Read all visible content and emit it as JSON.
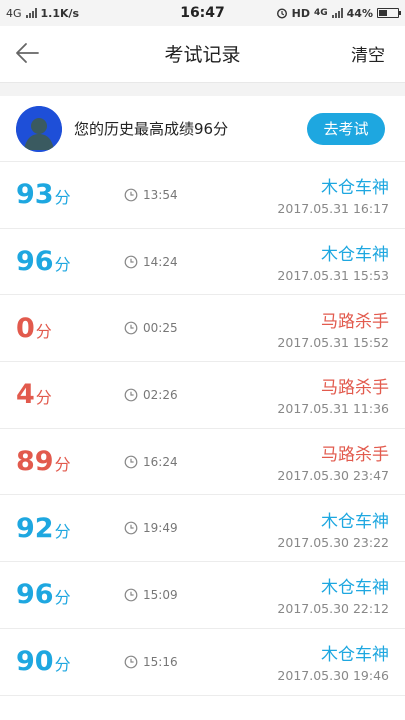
{
  "status": {
    "net": "4G",
    "speed": "1.1K/s",
    "time": "16:47",
    "hd": "HD",
    "net2": "4G",
    "battery": "44%",
    "battery_level": 0.44
  },
  "header": {
    "title": "考试记录",
    "clear": "清空",
    "back_icon": "arrow-left-icon"
  },
  "best": {
    "text": "您的历史最高成绩96分",
    "button": "去考试"
  },
  "colors": {
    "pass": "#1ea7e0",
    "fail": "#e25a4d"
  },
  "unit": "分",
  "records": [
    {
      "score": "93",
      "duration": "13:54",
      "title": "木仓车神",
      "date": "2017.05.31  16:17",
      "status": "pass"
    },
    {
      "score": "96",
      "duration": "14:24",
      "title": "木仓车神",
      "date": "2017.05.31  15:53",
      "status": "pass"
    },
    {
      "score": "0",
      "duration": "00:25",
      "title": "马路杀手",
      "date": "2017.05.31  15:52",
      "status": "fail"
    },
    {
      "score": "4",
      "duration": "02:26",
      "title": "马路杀手",
      "date": "2017.05.31  11:36",
      "status": "fail"
    },
    {
      "score": "89",
      "duration": "16:24",
      "title": "马路杀手",
      "date": "2017.05.30  23:47",
      "status": "fail"
    },
    {
      "score": "92",
      "duration": "19:49",
      "title": "木仓车神",
      "date": "2017.05.30  23:22",
      "status": "pass"
    },
    {
      "score": "96",
      "duration": "15:09",
      "title": "木仓车神",
      "date": "2017.05.30  22:12",
      "status": "pass"
    },
    {
      "score": "90",
      "duration": "15:16",
      "title": "木仓车神",
      "date": "2017.05.30  19:46",
      "status": "pass"
    }
  ]
}
